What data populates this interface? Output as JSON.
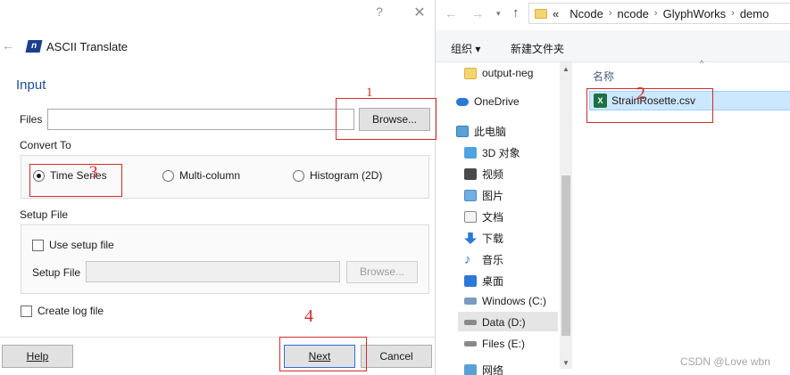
{
  "dialog": {
    "title": "ASCII Translate",
    "logo_text": "n",
    "help_glyph": "?",
    "close_glyph": "✕",
    "section_title": "Input",
    "files_label": "Files",
    "files_value": "",
    "browse_label": "Browse...",
    "convert_label": "Convert To",
    "convert_options": [
      {
        "label": "Time Series",
        "checked": true
      },
      {
        "label": "Multi-column",
        "checked": false
      },
      {
        "label": "Histogram (2D)",
        "checked": false
      }
    ],
    "setup_file_label": "Setup File",
    "use_setup_label": "Use setup file",
    "setup_file_field_label": "Setup File",
    "setup_browse_label": "Browse...",
    "create_log_label": "Create log file",
    "help_label": "Help",
    "next_label": "Next",
    "cancel_label": "Cancel"
  },
  "annotations": {
    "one": "1",
    "two": "2",
    "three": "3",
    "four": "4"
  },
  "explorer": {
    "breadcrumb": [
      "«",
      "Ncode",
      "ncode",
      "GlyphWorks",
      "demo"
    ],
    "organize_label": "组织 ▾",
    "new_folder_label": "新建文件夹",
    "nav_items": [
      {
        "label": "output-neg",
        "icon": "folder-icon"
      },
      {
        "label": "OneDrive",
        "icon": "cloud-icon"
      },
      {
        "label": "此电脑",
        "icon": "computer-icon"
      },
      {
        "label": "3D 对象",
        "icon": "cube-icon"
      },
      {
        "label": "视频",
        "icon": "video-icon"
      },
      {
        "label": "图片",
        "icon": "picture-icon"
      },
      {
        "label": "文档",
        "icon": "document-icon"
      },
      {
        "label": "下载",
        "icon": "download-icon"
      },
      {
        "label": "音乐",
        "icon": "music-icon"
      },
      {
        "label": "桌面",
        "icon": "desktop-icon"
      },
      {
        "label": "Windows (C:)",
        "icon": "drive-icon"
      },
      {
        "label": "Data (D:)",
        "icon": "drive-icon"
      },
      {
        "label": "Files (E:)",
        "icon": "drive-icon"
      },
      {
        "label": "网络",
        "icon": "network-icon"
      }
    ],
    "column_name": "名称",
    "file": {
      "name": "StrainRosette.csv",
      "icon": "excel-file-icon",
      "icon_text": "X"
    }
  },
  "watermark": "CSDN @Love wbn",
  "colors": {
    "accent": "#1b4f9c",
    "annotation": "#d42a2a",
    "selection": "#cce8ff"
  }
}
